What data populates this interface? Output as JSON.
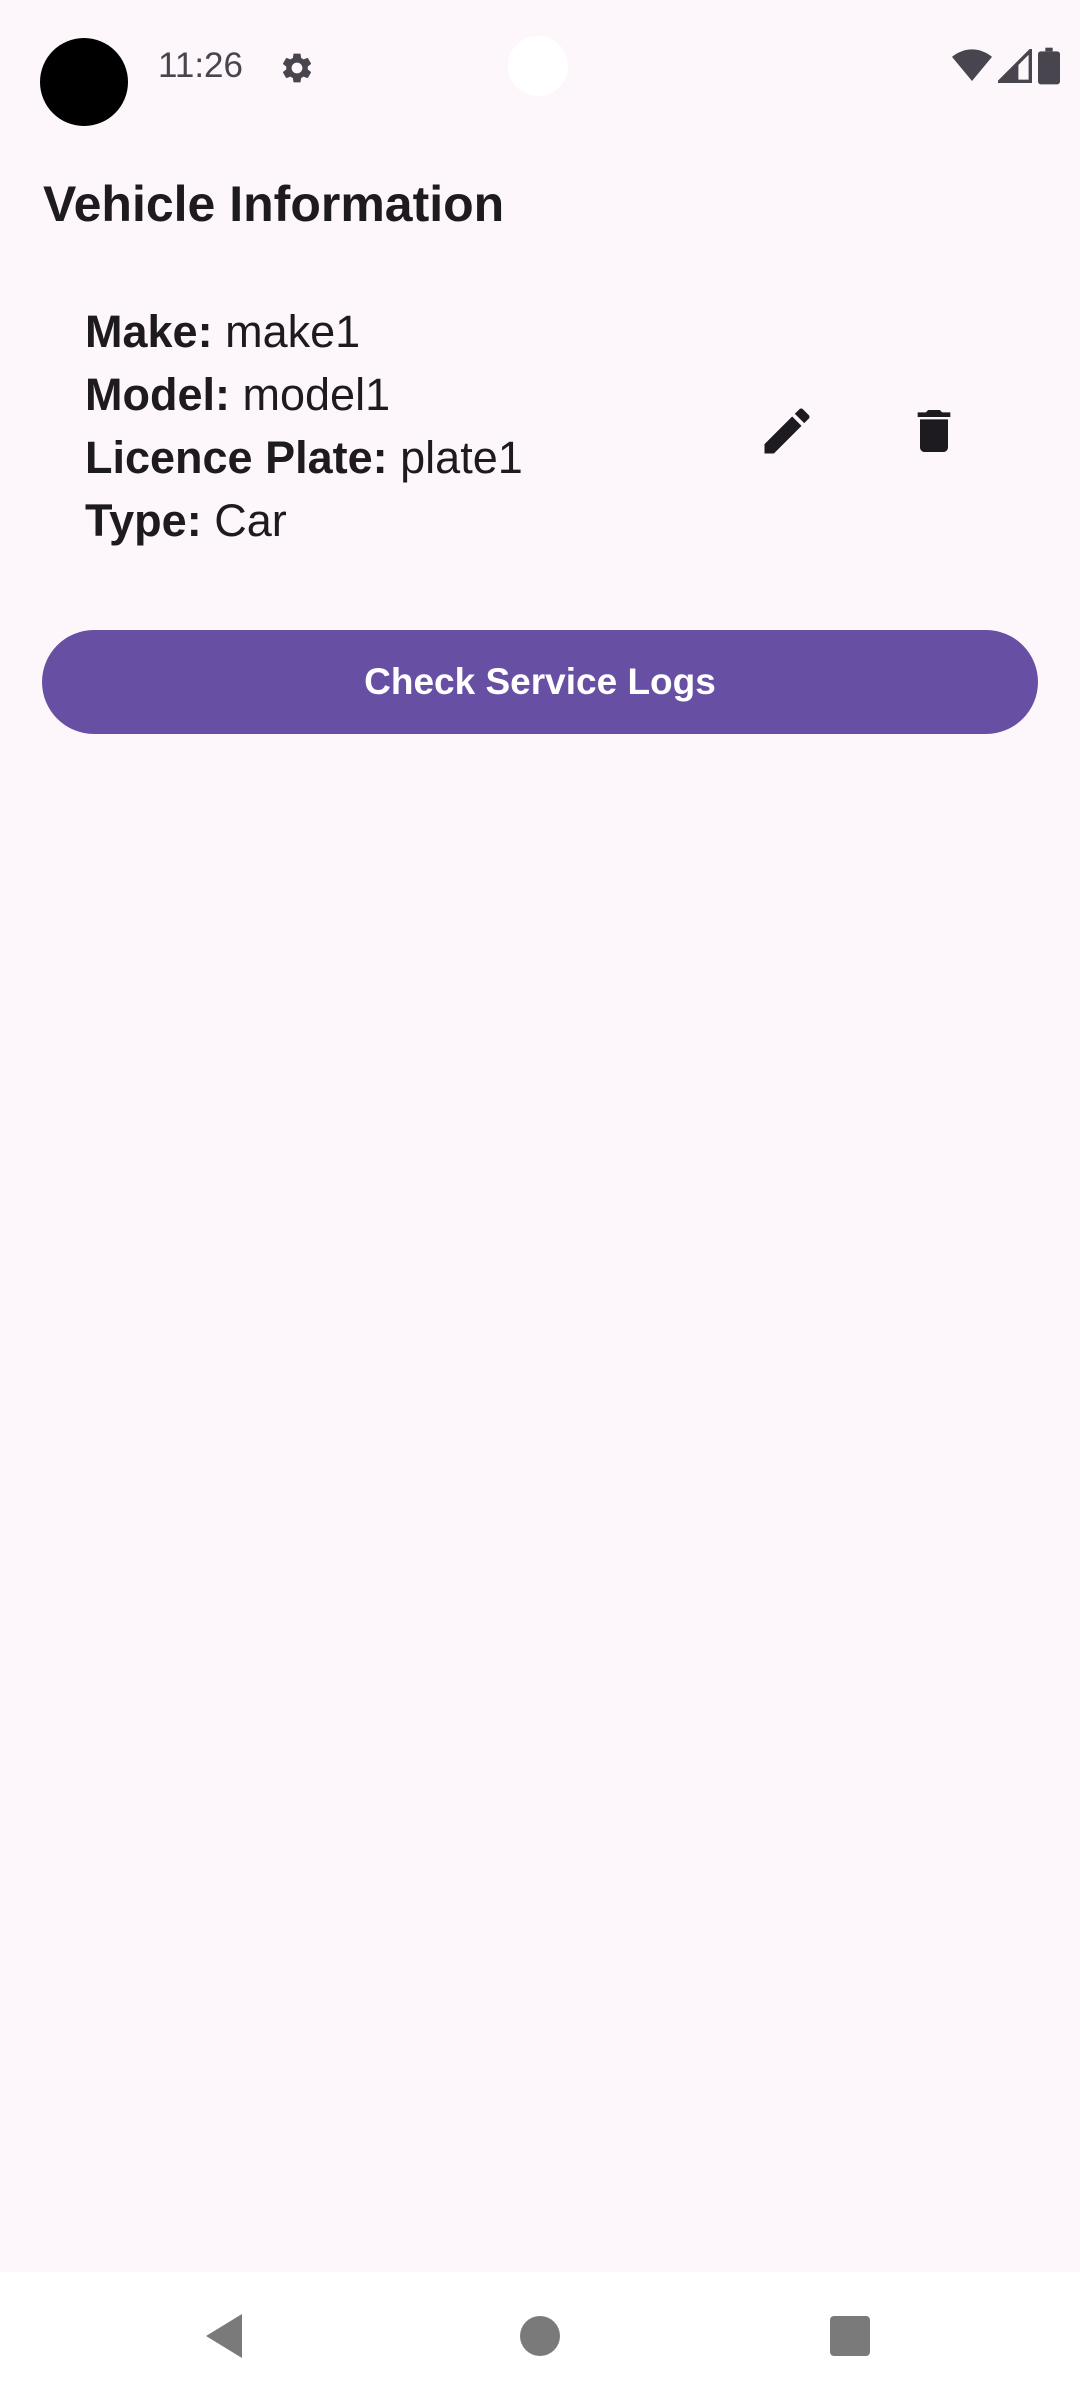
{
  "status_bar": {
    "time": "11:26",
    "icons": [
      "settings-icon",
      "wifi-icon",
      "signal-icon",
      "battery-icon"
    ]
  },
  "page": {
    "title": "Vehicle Information"
  },
  "vehicle": {
    "make_label": "Make:",
    "make_value": "make1",
    "model_label": "Model:",
    "model_value": "model1",
    "plate_label": "Licence Plate:",
    "plate_value": "plate1",
    "type_label": "Type:",
    "type_value": "Car"
  },
  "actions": {
    "edit_icon": "pencil-icon",
    "delete_icon": "trash-icon",
    "service_logs_label": "Check Service Logs"
  },
  "navigation": {
    "icons": [
      "back-icon",
      "home-icon",
      "recents-icon"
    ]
  },
  "colors": {
    "background": "#fdf7fc",
    "primary": "#6750a4",
    "on_primary": "#ffffff",
    "text": "#1d1b20"
  }
}
